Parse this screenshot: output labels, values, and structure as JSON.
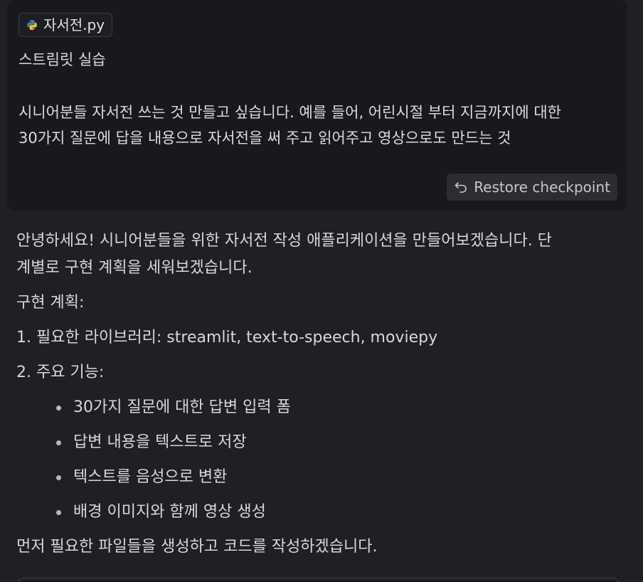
{
  "user_message": {
    "file_chip": {
      "icon": "python-icon",
      "name": "자서전.py"
    },
    "title": "스트림릿 실습",
    "body_lines": [
      "시니어분들 자서전 쓰는 것 만들고 싶습니다.  예를 들어, 어린시절 부터 지금까지에 대한",
      "30가지 질문에 답을 내용으로 자서전을 써 주고 읽어주고 영상으로도 만드는 것"
    ],
    "restore_button": {
      "icon": "undo-icon",
      "label": "Restore checkpoint"
    }
  },
  "assistant_message": {
    "intro_lines": [
      "안녕하세요! 시니어분들을 위한 자서전 작성 애플리케이션을 만들어보겠습니다. 단",
      "계별로 구현 계획을 세워보겠습니다."
    ],
    "plan_heading": "구현 계획:",
    "steps": [
      "1. 필요한 라이브러리: streamlit, text-to-speech, moviepy",
      "2. 주요 기능:"
    ],
    "features": [
      "30가지 질문에 대한 답변 입력 폼",
      "답변 내용을 텍스트로 저장",
      "텍스트를 음성으로 변환",
      "배경 이미지와 함께 영상 생성"
    ],
    "outro": "먼저 필요한 파일들을 생성하고 코드를 작성하겠습니다."
  },
  "colors": {
    "background": "#1f2023",
    "card": "#18191c",
    "button": "#2c2d31",
    "text": "#d8d8db",
    "python_blue": "#4a7fb5",
    "python_yellow": "#f0c542"
  }
}
